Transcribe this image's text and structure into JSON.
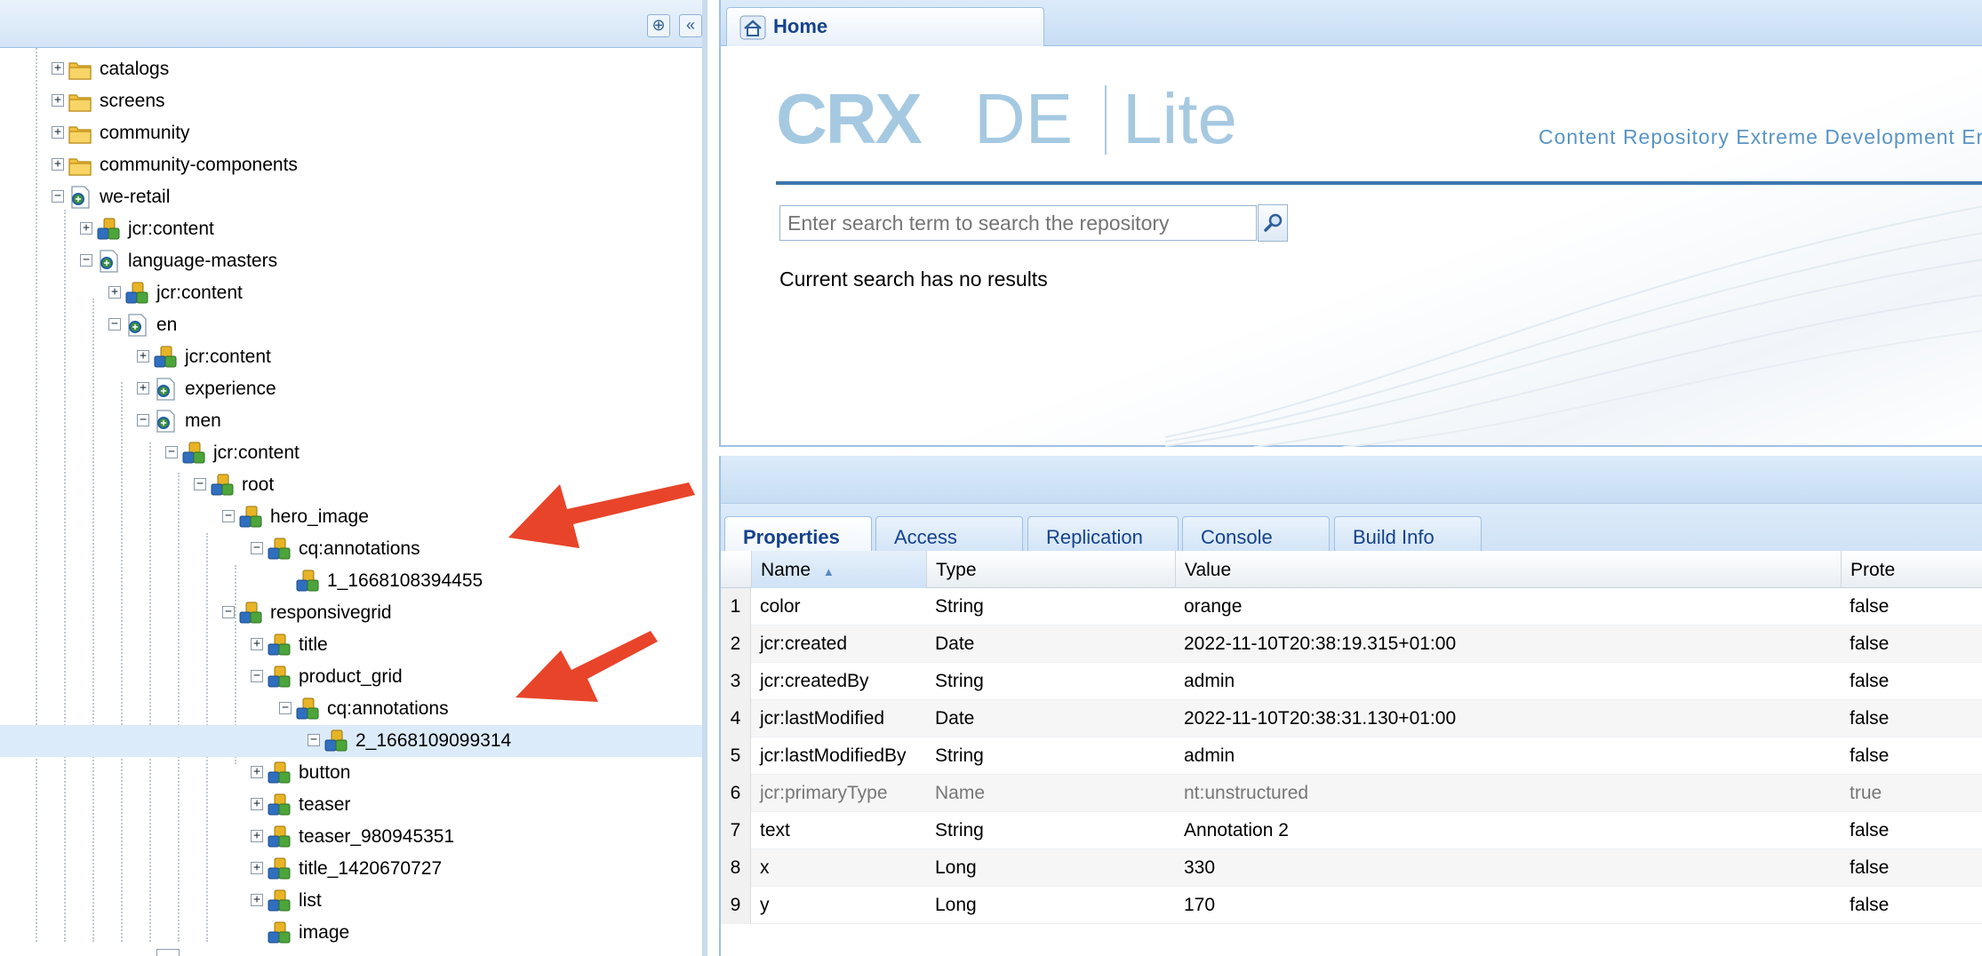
{
  "tree": {
    "nodes": [
      {
        "label": "catalogs",
        "icon": "folder-icon",
        "toggle": "+"
      },
      {
        "label": "screens",
        "icon": "folder-icon",
        "toggle": "+"
      },
      {
        "label": "community",
        "icon": "folder-icon",
        "toggle": "+"
      },
      {
        "label": "community-components",
        "icon": "folder-icon",
        "toggle": "+"
      },
      {
        "label": "we-retail",
        "icon": "page-icon",
        "toggle": "−"
      },
      {
        "label": "jcr:content",
        "icon": "node-icon",
        "toggle": "+"
      },
      {
        "label": "language-masters",
        "icon": "page-icon",
        "toggle": "−"
      },
      {
        "label": "jcr:content",
        "icon": "node-icon",
        "toggle": "+"
      },
      {
        "label": "en",
        "icon": "page-icon",
        "toggle": "−"
      },
      {
        "label": "jcr:content",
        "icon": "node-icon",
        "toggle": "+"
      },
      {
        "label": "experience",
        "icon": "page-icon",
        "toggle": "+"
      },
      {
        "label": "men",
        "icon": "page-icon",
        "toggle": "−"
      },
      {
        "label": "jcr:content",
        "icon": "node-icon",
        "toggle": "−"
      },
      {
        "label": "root",
        "icon": "node-icon",
        "toggle": "−"
      },
      {
        "label": "hero_image",
        "icon": "node-icon",
        "toggle": "−"
      },
      {
        "label": "cq:annotations",
        "icon": "node-icon",
        "toggle": "−"
      },
      {
        "label": "1_1668108394455",
        "icon": "node-icon",
        "toggle": ""
      },
      {
        "label": "responsivegrid",
        "icon": "node-icon",
        "toggle": "−"
      },
      {
        "label": "title",
        "icon": "node-icon",
        "toggle": "+"
      },
      {
        "label": "product_grid",
        "icon": "node-icon",
        "toggle": "−"
      },
      {
        "label": "cq:annotations",
        "icon": "node-icon",
        "toggle": "−"
      },
      {
        "label": "2_1668109099314",
        "icon": "node-icon",
        "toggle": "−",
        "selected": true
      },
      {
        "label": "button",
        "icon": "node-icon",
        "toggle": "+"
      },
      {
        "label": "teaser",
        "icon": "node-icon",
        "toggle": "+"
      },
      {
        "label": "teaser_980945351",
        "icon": "node-icon",
        "toggle": "+"
      },
      {
        "label": "title_1420670727",
        "icon": "node-icon",
        "toggle": "+"
      },
      {
        "label": "list",
        "icon": "node-icon",
        "toggle": "+"
      },
      {
        "label": "image",
        "icon": "node-icon",
        "toggle": ""
      }
    ]
  },
  "home": {
    "tab_label": "Home",
    "logo_crx": "CRX",
    "logo_de": "DE",
    "logo_lite": "Lite",
    "tagline": "Content Repository Extreme Development Env",
    "search_placeholder": "Enter search term to search the repository",
    "search_result": "Current search has no results"
  },
  "properties": {
    "tabs": [
      "Properties",
      "Access Control",
      "Replication",
      "Console",
      "Build Info"
    ],
    "columns": [
      "Name",
      "Type",
      "Value",
      "Prote"
    ],
    "rows": [
      {
        "num": "1",
        "name": "color",
        "type": "String",
        "value": "orange",
        "protected": "false"
      },
      {
        "num": "2",
        "name": "jcr:created",
        "type": "Date",
        "value": "2022-11-10T20:38:19.315+01:00",
        "protected": "false"
      },
      {
        "num": "3",
        "name": "jcr:createdBy",
        "type": "String",
        "value": "admin",
        "protected": "false"
      },
      {
        "num": "4",
        "name": "jcr:lastModified",
        "type": "Date",
        "value": "2022-11-10T20:38:31.130+01:00",
        "protected": "false"
      },
      {
        "num": "5",
        "name": "jcr:lastModifiedBy",
        "type": "String",
        "value": "admin",
        "protected": "false"
      },
      {
        "num": "6",
        "name": "jcr:primaryType",
        "type": "Name",
        "value": "nt:unstructured",
        "protected": "true"
      },
      {
        "num": "7",
        "name": "text",
        "type": "String",
        "value": "Annotation 2",
        "protected": "false"
      },
      {
        "num": "8",
        "name": "x",
        "type": "Long",
        "value": "330",
        "protected": "false"
      },
      {
        "num": "9",
        "name": "y",
        "type": "Long",
        "value": "170",
        "protected": "false"
      }
    ]
  },
  "colors": {
    "accent": "#15428b",
    "arrow": "#e8442a",
    "selection": "#dcebfa"
  }
}
